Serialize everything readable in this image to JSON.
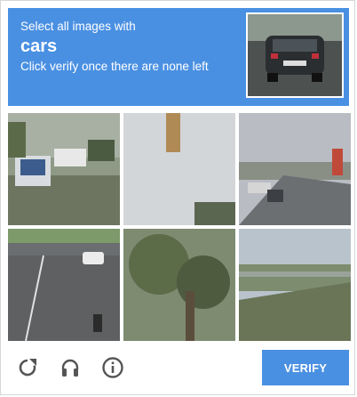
{
  "header": {
    "instruction": "Select all images with",
    "object": "cars",
    "subtext": "Click verify once there are none left"
  },
  "grid": {
    "rows": 2,
    "cols": 3,
    "tiles": [
      {
        "label": "tile-1"
      },
      {
        "label": "tile-2"
      },
      {
        "label": "tile-3"
      },
      {
        "label": "tile-4"
      },
      {
        "label": "tile-5"
      },
      {
        "label": "tile-6"
      }
    ]
  },
  "footer": {
    "icons": [
      "reload-icon",
      "audio-icon",
      "info-icon"
    ],
    "verify_label": "VERIFY"
  },
  "colors": {
    "accent": "#4a90e2",
    "icon": "#555555"
  }
}
